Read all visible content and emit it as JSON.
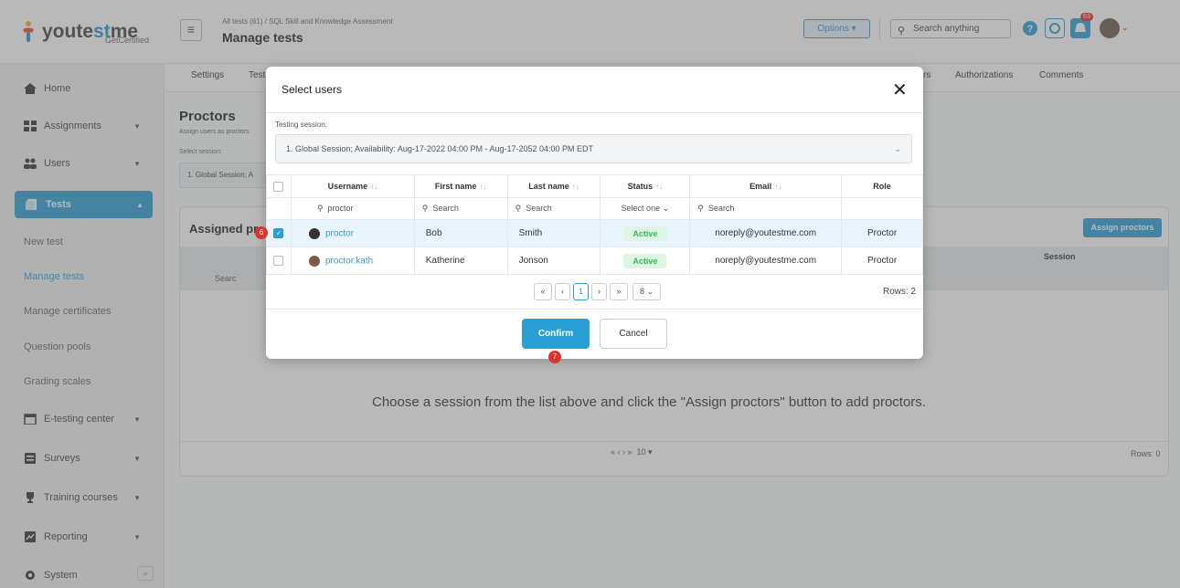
{
  "logo": {
    "name_dark": "youte",
    "name_blue": "st",
    "name_dark2": "me",
    "sub": "GetCertified"
  },
  "sidebar": {
    "items": [
      {
        "label": "Home"
      },
      {
        "label": "Assignments"
      },
      {
        "label": "Users"
      },
      {
        "label": "Tests"
      },
      {
        "label": "E-testing center"
      },
      {
        "label": "Surveys"
      },
      {
        "label": "Training courses"
      },
      {
        "label": "Reporting"
      },
      {
        "label": "System"
      }
    ],
    "sub_items": [
      "New test",
      "Manage tests",
      "Manage certificates",
      "Question pools",
      "Grading scales"
    ],
    "collapse_icon": "«"
  },
  "header": {
    "breadcrumb": "All tests (61)  /  SQL Skill and Knowledge Assessment",
    "title": "Manage tests",
    "options_label": "Options ▾",
    "search_placeholder": "Search anything",
    "notification_count": "63"
  },
  "tabs": [
    "Settings",
    "Test",
    "rs",
    "Authorizations",
    "Comments"
  ],
  "page": {
    "section_title": "Proctors",
    "section_sub": "Assign users as proctors",
    "select_session_label": "Select session:",
    "session_value": "1. Global Session; A",
    "assigned_title": "Assigned pro",
    "assign_button": "Assign proctors",
    "session_col": "Session",
    "search_cut": "Searc",
    "empty_message": "Choose a session from the list above and click the \"Assign proctors\" button to add proctors.",
    "page_size": "10",
    "rows": "Rows: 0"
  },
  "modal": {
    "title": "Select users",
    "close": "✕",
    "testing_session_label": "Testing session:",
    "session": "1. Global Session; Availability: Aug-17-2022 04:00 PM - Aug-17-2052 04:00 PM EDT",
    "columns": [
      "Username",
      "First name",
      "Last name",
      "Status",
      "Email",
      "Role"
    ],
    "filters": {
      "username": "proctor",
      "first": "Search",
      "last": "Search",
      "status": "Select one",
      "email": "Search"
    },
    "rows": [
      {
        "username": "proctor",
        "first": "Bob",
        "last": "Smith",
        "status": "Active",
        "email": "noreply@youtestme.com",
        "role": "Proctor",
        "selected": true
      },
      {
        "username": "proctor.kath",
        "first": "Katherine",
        "last": "Jonson",
        "status": "Active",
        "email": "noreply@youtestme.com",
        "role": "Proctor",
        "selected": false
      }
    ],
    "pagination": {
      "current": "1",
      "page_size": "8"
    },
    "rows_count": "Rows: 2",
    "confirm_label": "Confirm",
    "cancel_label": "Cancel",
    "markers": [
      "6",
      "7"
    ]
  },
  "colors": {
    "accent": "#2a9fd6",
    "active_green": "#3cb657",
    "marker_red": "#d9352b"
  }
}
